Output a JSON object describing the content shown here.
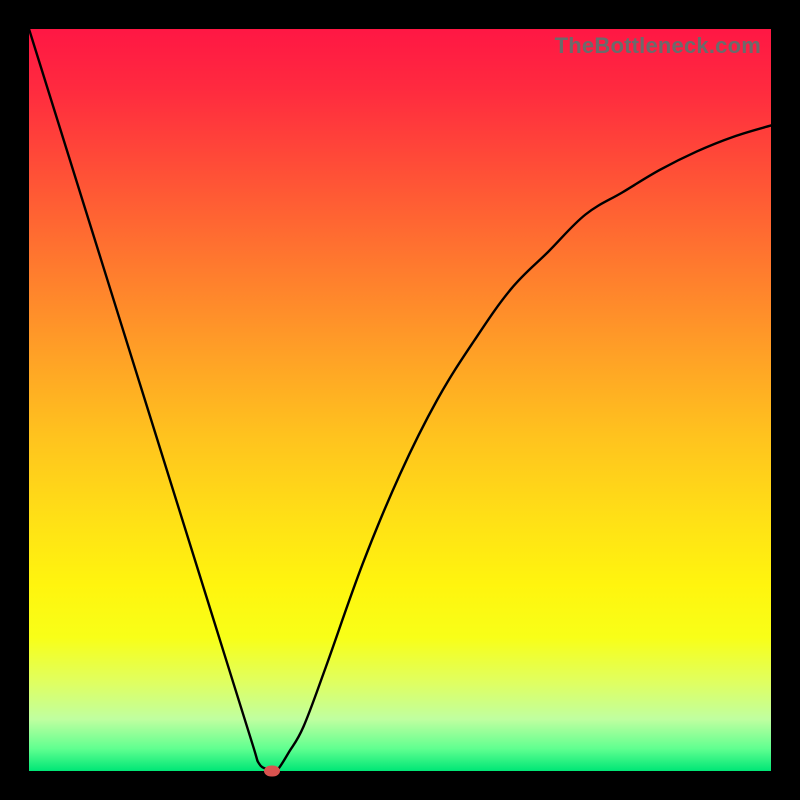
{
  "watermark": "TheBottleneck.com",
  "chart_data": {
    "type": "line",
    "title": "",
    "xlabel": "",
    "ylabel": "",
    "xlim": [
      0,
      100
    ],
    "ylim": [
      0,
      100
    ],
    "grid": false,
    "series": [
      {
        "name": "curve",
        "x": [
          0,
          5,
          10,
          15,
          20,
          25,
          30,
          31,
          32.2,
          32.8,
          33.6,
          35,
          37,
          40,
          45,
          50,
          55,
          60,
          65,
          70,
          75,
          80,
          85,
          90,
          95,
          100
        ],
        "values": [
          100,
          84,
          68,
          52,
          36,
          20,
          4,
          1,
          0.2,
          0,
          0.3,
          2.5,
          6,
          14,
          28,
          40,
          50,
          58,
          65,
          70,
          75,
          78,
          81,
          83.5,
          85.5,
          87
        ]
      }
    ],
    "marker": {
      "x": 32.8,
      "y": 0
    },
    "colors": {
      "curve": "#000000",
      "marker": "#d9534f",
      "gradient_top": "#ff1744",
      "gradient_bottom": "#00e676"
    }
  }
}
